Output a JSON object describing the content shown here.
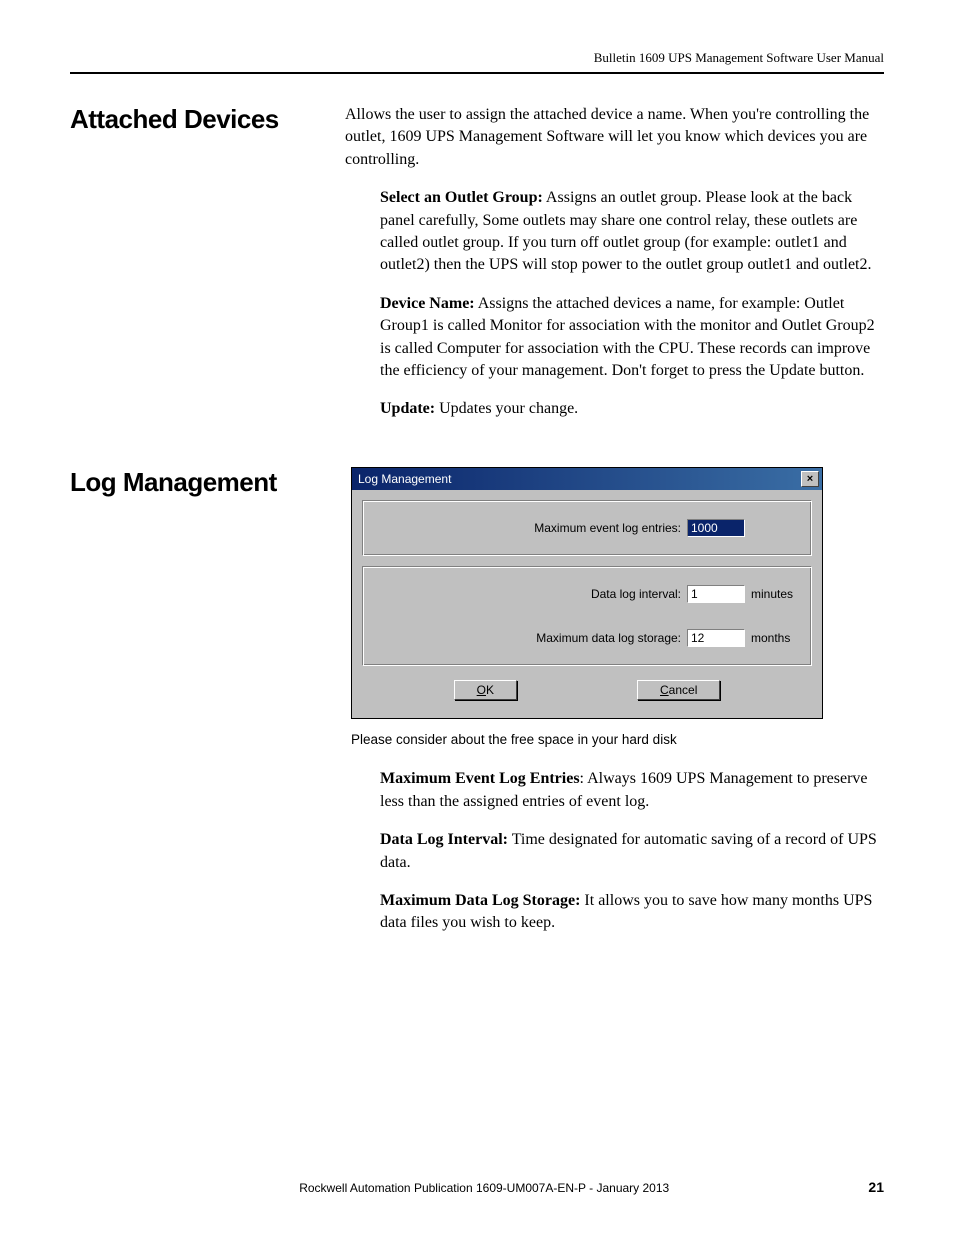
{
  "header": {
    "running_head": "Bulletin 1609 UPS Management Software User Manual"
  },
  "section1": {
    "heading": "Attached Devices",
    "intro": "Allows the user to assign the attached device a name. When you're controlling the outlet, 1609 UPS Management Software will let you know which devices you are controlling.",
    "items": [
      {
        "lead": "Select an Outlet Group:",
        "text": " Assigns an outlet group. Please look at the back panel carefully, Some outlets may share one control relay, these outlets are called outlet group. If you turn off outlet group (for example: outlet1 and outlet2) then the UPS will stop power to the outlet group outlet1 and outlet2."
      },
      {
        "lead": "Device Name:",
        "text": " Assigns the attached devices a name, for example: Outlet Group1 is called Monitor for association with the monitor and Outlet Group2 is called Computer for association with the CPU. These records can improve the efficiency of your management. Don't forget to press the Update button."
      },
      {
        "lead": "Update:",
        "text": " Updates your change."
      }
    ]
  },
  "section2": {
    "heading": "Log Management",
    "dialog": {
      "title": "Log Management",
      "fields": {
        "max_event_label": "Maximum event log entries:",
        "max_event_value": "1000",
        "data_interval_label": "Data log interval:",
        "data_interval_value": "1",
        "data_interval_unit": "minutes",
        "max_storage_label": "Maximum data log storage:",
        "max_storage_value": "12",
        "max_storage_unit": "months"
      },
      "ok_label": "OK",
      "cancel_label": "Cancel"
    },
    "caption": "Please consider about the free space in your hard disk",
    "items": [
      {
        "lead": "Maximum Event Log Entries",
        "text": ": Always 1609 UPS Management to preserve less than the assigned entries of event log."
      },
      {
        "lead": "Data Log Interval:",
        "text": " Time designated for automatic saving of a record of UPS data."
      },
      {
        "lead": "Maximum Data Log Storage:",
        "text": " It allows you to save how many months UPS data files you wish to keep."
      }
    ]
  },
  "footer": {
    "pub": "Rockwell Automation Publication 1609-UM007A-EN-P - January 2013",
    "page": "21"
  }
}
